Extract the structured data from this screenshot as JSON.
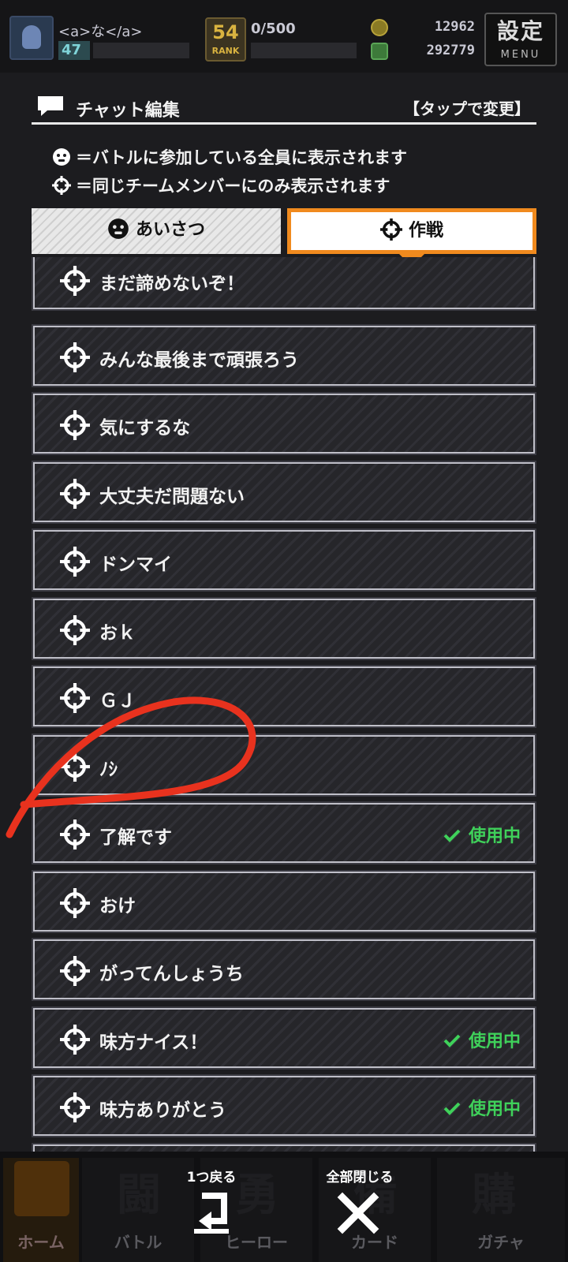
{
  "topbar": {
    "player_name": "<a>な</a>",
    "level": "47",
    "rank_number": "54",
    "rank_word": "RANK",
    "rank_progress": "0/500",
    "coins": "12962",
    "gems": "292779",
    "settings_label": "設定",
    "settings_sub": "MENU"
  },
  "panel": {
    "title": "チャット編集",
    "hint": "【タップで変更】",
    "legend_all": "＝バトルに参加している全員に表示されます",
    "legend_team": "＝同じチームメンバーにのみ表示されます"
  },
  "tabs": {
    "greeting": "あいさつ",
    "tactics": "作戦"
  },
  "messages": [
    {
      "label": "まだ諦めないぞ！",
      "status": ""
    },
    {
      "label": "みんな最後まで頑張ろう",
      "status": ""
    },
    {
      "label": "気にするな",
      "status": ""
    },
    {
      "label": "大丈夫だ問題ない",
      "status": ""
    },
    {
      "label": "ドンマイ",
      "status": ""
    },
    {
      "label": "おｋ",
      "status": ""
    },
    {
      "label": "ＧＪ",
      "status": ""
    },
    {
      "label": "ﾉｼ",
      "status": ""
    },
    {
      "label": "了解です",
      "status": "使用中"
    },
    {
      "label": "おけ",
      "status": ""
    },
    {
      "label": "がってんしょうち",
      "status": ""
    },
    {
      "label": "味方ナイス！",
      "status": "使用中"
    },
    {
      "label": "味方ありがとう",
      "status": "使用中"
    },
    {
      "label": "",
      "status": ""
    }
  ],
  "bottom_nav": {
    "home": "ホーム",
    "battle": "バトル",
    "hero": "ヒーロー",
    "card": "カード",
    "gacha": "ガチャ",
    "battle_big": "闘",
    "hero_big": "勇",
    "card_big": "備",
    "gacha_big": "購"
  },
  "actions": {
    "back": "1つ戻る",
    "close_all": "全部閉じる"
  },
  "colors": {
    "accent": "#f08a1e",
    "in_use": "#3fd15a",
    "annotation": "#e8321e"
  }
}
